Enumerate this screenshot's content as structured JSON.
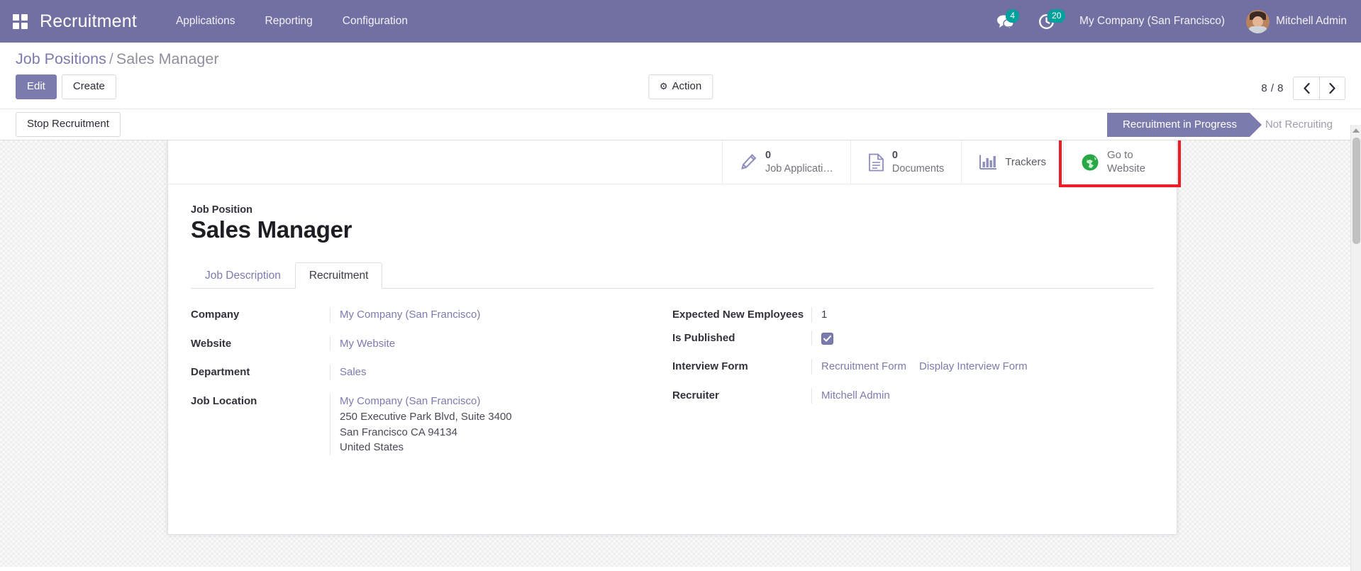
{
  "navbar": {
    "apps_icon": "grid-apps-icon",
    "brand": "Recruitment",
    "menus": [
      {
        "label": "Applications"
      },
      {
        "label": "Reporting"
      },
      {
        "label": "Configuration"
      }
    ],
    "messages_icon": "comments-icon",
    "messages_count": "4",
    "activity_icon": "clock-activity-icon",
    "activity_count": "20",
    "company": "My Company (San Francisco)",
    "user": "Mitchell Admin",
    "avatar_icon": "user-avatar",
    "brand_color": "#7270a2",
    "badge_color": "#00a09d"
  },
  "control_panel": {
    "breadcrumb_root": "Job Positions",
    "breadcrumb_sep": "/",
    "breadcrumb_current": "Sales Manager",
    "edit_label": "Edit",
    "create_label": "Create",
    "action_label": "Action",
    "action_icon": "gear-icon",
    "pager_text": "8 / 8",
    "prev_icon": "chevron-left-icon",
    "next_icon": "chevron-right-icon"
  },
  "statusbar": {
    "stop_recruitment_label": "Stop Recruitment",
    "stages": [
      {
        "label": "Recruitment in Progress",
        "active": true
      },
      {
        "label": "Not Recruiting",
        "active": false
      }
    ],
    "active_color": "#7c7bad"
  },
  "button_box": [
    {
      "icon": "pencil-icon",
      "value": "0",
      "label": "Job Applicati…",
      "name": "job-applications-stat-button"
    },
    {
      "icon": "document-icon",
      "value": "0",
      "label": "Documents",
      "name": "documents-stat-button"
    },
    {
      "icon": "bar-chart-icon",
      "value": "",
      "label": "Trackers",
      "name": "trackers-stat-button"
    },
    {
      "icon": "globe-icon",
      "value": "",
      "label": "Go to Website",
      "name": "go-to-website-button",
      "highlighted": true,
      "highlight_color": "#ee1c25"
    }
  ],
  "form": {
    "title_label": "Job Position",
    "title_value": "Sales Manager",
    "tabs": [
      {
        "label": "Job Description",
        "active": false
      },
      {
        "label": "Recruitment",
        "active": true
      }
    ],
    "left_fields": {
      "company_label": "Company",
      "company_value": "My Company (San Francisco)",
      "website_label": "Website",
      "website_value": "My Website",
      "department_label": "Department",
      "department_value": "Sales",
      "job_location_label": "Job Location",
      "job_location_name": "My Company (San Francisco)",
      "job_location_street": "250 Executive Park Blvd, Suite 3400",
      "job_location_city": "San Francisco CA 94134",
      "job_location_country": "United States"
    },
    "right_fields": {
      "expected_label": "Expected New Employees",
      "expected_value": "1",
      "published_label": "Is Published",
      "published_checked": true,
      "interview_form_label": "Interview Form",
      "interview_form_value": "Recruitment Form",
      "display_interview_form_label": "Display Interview Form",
      "recruiter_label": "Recruiter",
      "recruiter_value": "Mitchell Admin"
    }
  }
}
